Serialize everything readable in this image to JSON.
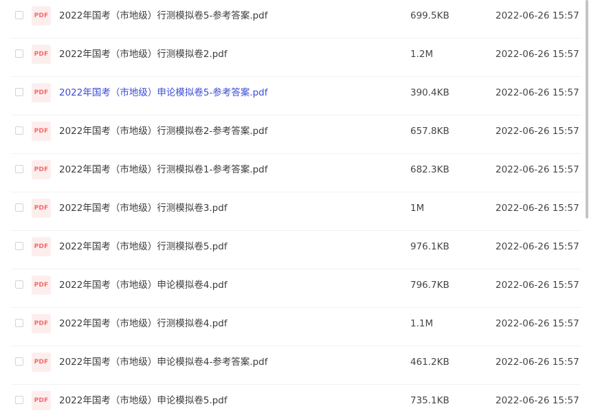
{
  "files": [
    {
      "icon": "PDF",
      "name": "2022年国考（市地级）行测模拟卷5-参考答案.pdf",
      "size": "699.5KB",
      "date": "2022-06-26 15:57"
    },
    {
      "icon": "PDF",
      "name": "2022年国考（市地级）行测模拟卷2.pdf",
      "size": "1.2M",
      "date": "2022-06-26 15:57"
    },
    {
      "icon": "PDF",
      "name": "2022年国考（市地级）申论模拟卷5-参考答案.pdf",
      "size": "390.4KB",
      "date": "2022-06-26 15:57"
    },
    {
      "icon": "PDF",
      "name": "2022年国考（市地级）行测模拟卷2-参考答案.pdf",
      "size": "657.8KB",
      "date": "2022-06-26 15:57"
    },
    {
      "icon": "PDF",
      "name": "2022年国考（市地级）行测模拟卷1-参考答案.pdf",
      "size": "682.3KB",
      "date": "2022-06-26 15:57"
    },
    {
      "icon": "PDF",
      "name": "2022年国考（市地级）行测模拟卷3.pdf",
      "size": "1M",
      "date": "2022-06-26 15:57"
    },
    {
      "icon": "PDF",
      "name": "2022年国考（市地级）行测模拟卷5.pdf",
      "size": "976.1KB",
      "date": "2022-06-26 15:57"
    },
    {
      "icon": "PDF",
      "name": "2022年国考（市地级）申论模拟卷4.pdf",
      "size": "796.7KB",
      "date": "2022-06-26 15:57"
    },
    {
      "icon": "PDF",
      "name": "2022年国考（市地级）行测模拟卷4.pdf",
      "size": "1.1M",
      "date": "2022-06-26 15:57"
    },
    {
      "icon": "PDF",
      "name": "2022年国考（市地级）申论模拟卷4-参考答案.pdf",
      "size": "461.2KB",
      "date": "2022-06-26 15:57"
    },
    {
      "icon": "PDF",
      "name": "2022年国考（市地级）申论模拟卷5.pdf",
      "size": "735.1KB",
      "date": "2022-06-26 15:57"
    }
  ],
  "colors": {
    "link_active": "#3a4bd6",
    "pdf_icon_bg": "#fdeeee",
    "pdf_icon_text": "#f26b6b"
  }
}
